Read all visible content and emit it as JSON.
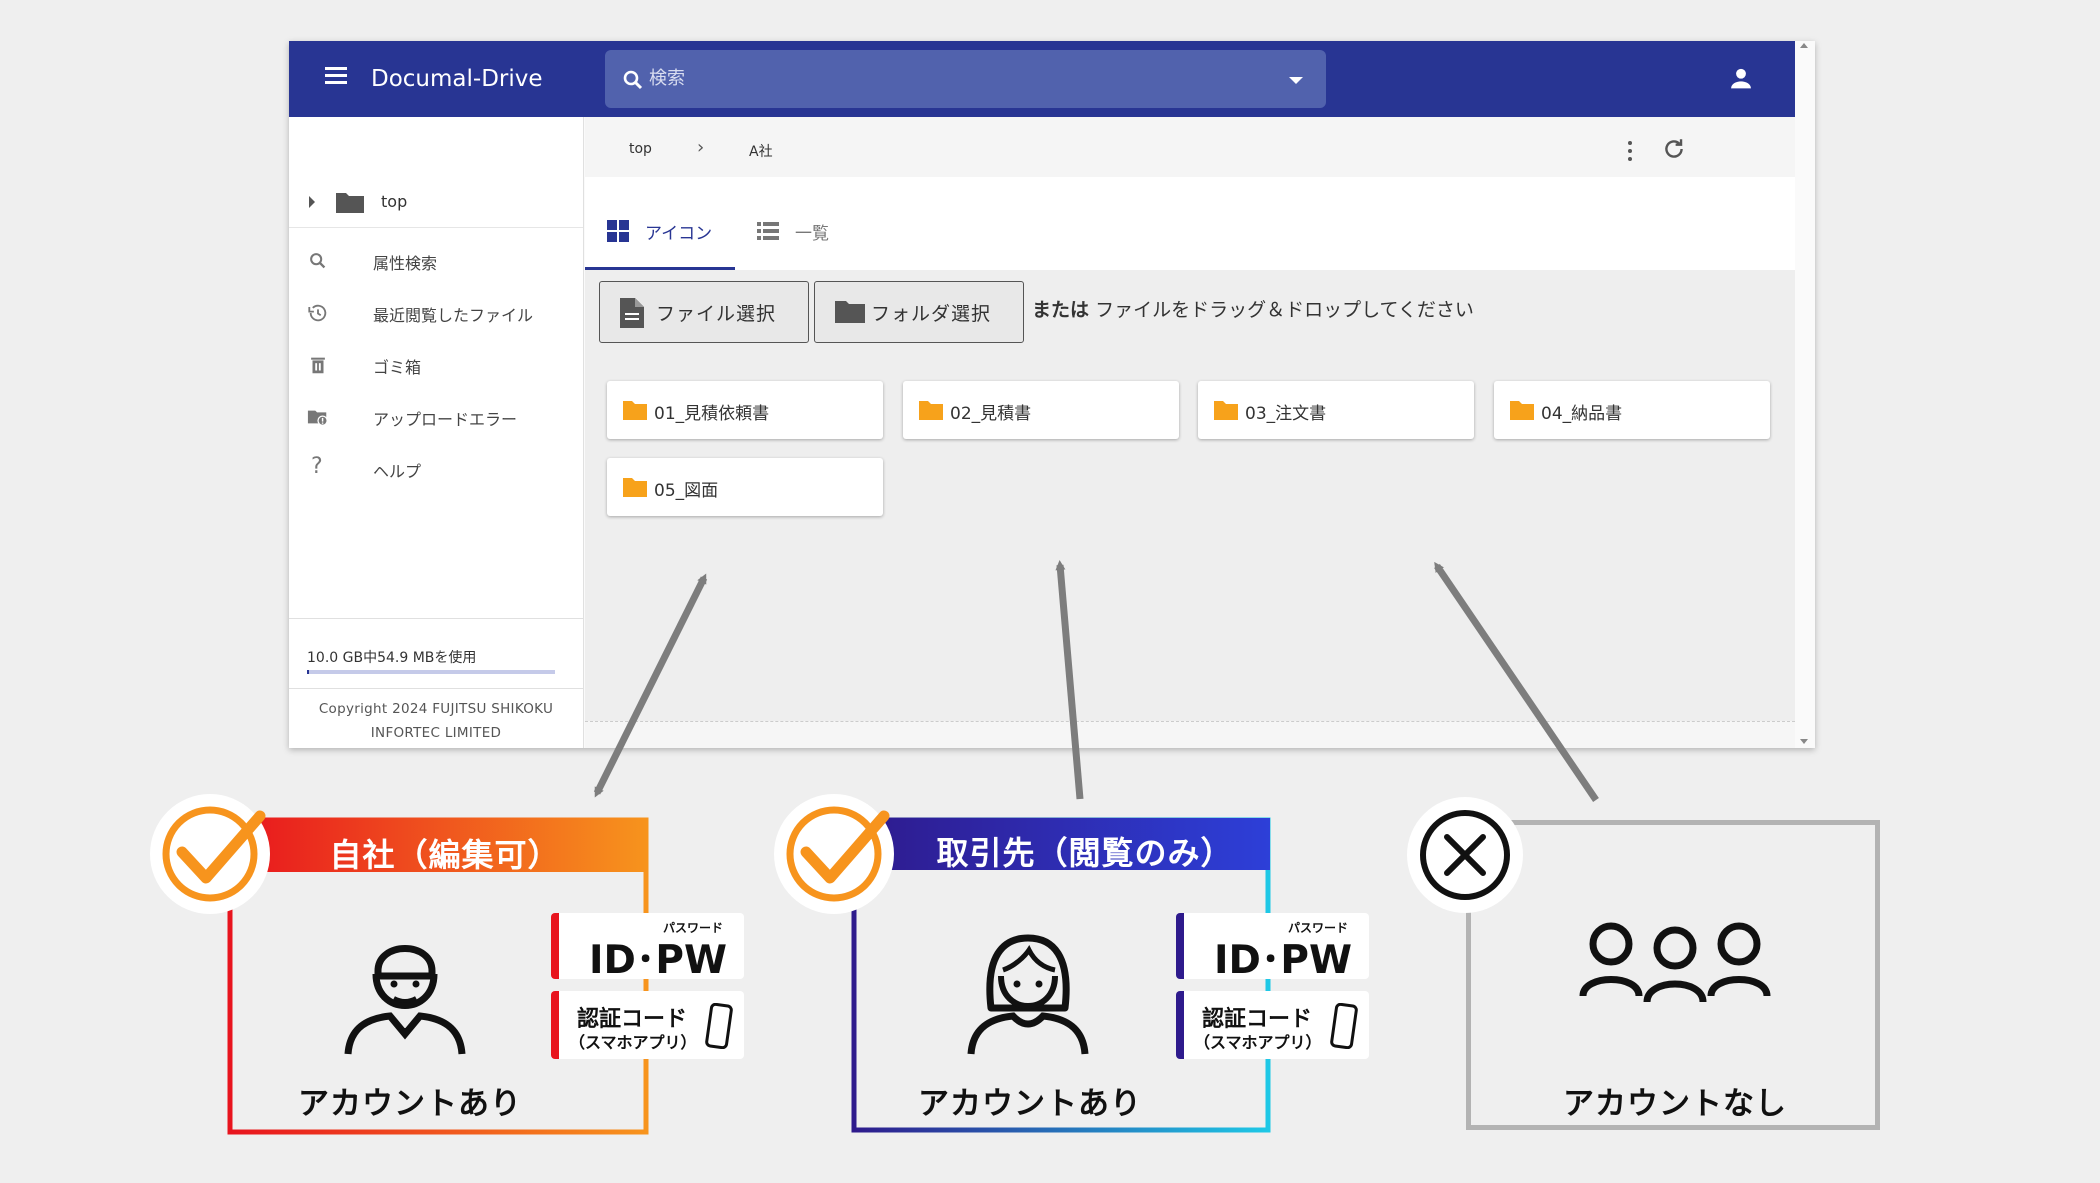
{
  "app": {
    "title": "Documal-Drive",
    "search_placeholder": "検索",
    "breadcrumb": [
      "top",
      "A社"
    ],
    "tree_root": "top",
    "tabs": [
      "アイコン",
      "一覧"
    ],
    "sidebar": [
      {
        "label": "属性検索",
        "icon": "search-icon"
      },
      {
        "label": "最近閲覧したファイル",
        "icon": "history-icon"
      },
      {
        "label": "ゴミ箱",
        "icon": "trash-icon"
      },
      {
        "label": "アップロードエラー",
        "icon": "upload-error-icon"
      },
      {
        "label": "ヘルプ",
        "icon": "help-icon"
      }
    ],
    "storage": "10.0 GB中54.9 MBを使用",
    "storage_used_fraction": 0.0054,
    "copyright": "Copyright 2024 FUJITSU SHIKOKU INFORTEC LIMITED",
    "upload_buttons": [
      "ファイル選択",
      "フォルダ選択"
    ],
    "drop_hint_bold": "または",
    "drop_hint": "ファイルをドラッグ＆ドロップしてください",
    "folders": [
      "01_見積依頼書",
      "02_見積書",
      "03_注文書",
      "04_納品書",
      "05_図面"
    ]
  },
  "panels": [
    {
      "title": "自社（編集可）",
      "label": "アカウントあり",
      "status": "check",
      "badge_top": "パスワード",
      "badge_id": "ID･PW",
      "badge_code": "認証コード",
      "badge_app": "（スマホアプリ）"
    },
    {
      "title": "取引先（閲覧のみ）",
      "label": "アカウントあり",
      "status": "check",
      "badge_top": "パスワード",
      "badge_id": "ID･PW",
      "badge_code": "認証コード",
      "badge_app": "（スマホアプリ）"
    },
    {
      "title": "",
      "label": "アカウントなし",
      "status": "cross"
    }
  ],
  "colors": {
    "topbar": "#283593",
    "accent_orange": "#f7941d",
    "panel1_gradient": [
      "#e8141e",
      "#f7941d"
    ],
    "panel2_gradient": [
      "#2e1a8c",
      "#1ec8e6"
    ],
    "panel3_border": "#b3b3b3"
  }
}
